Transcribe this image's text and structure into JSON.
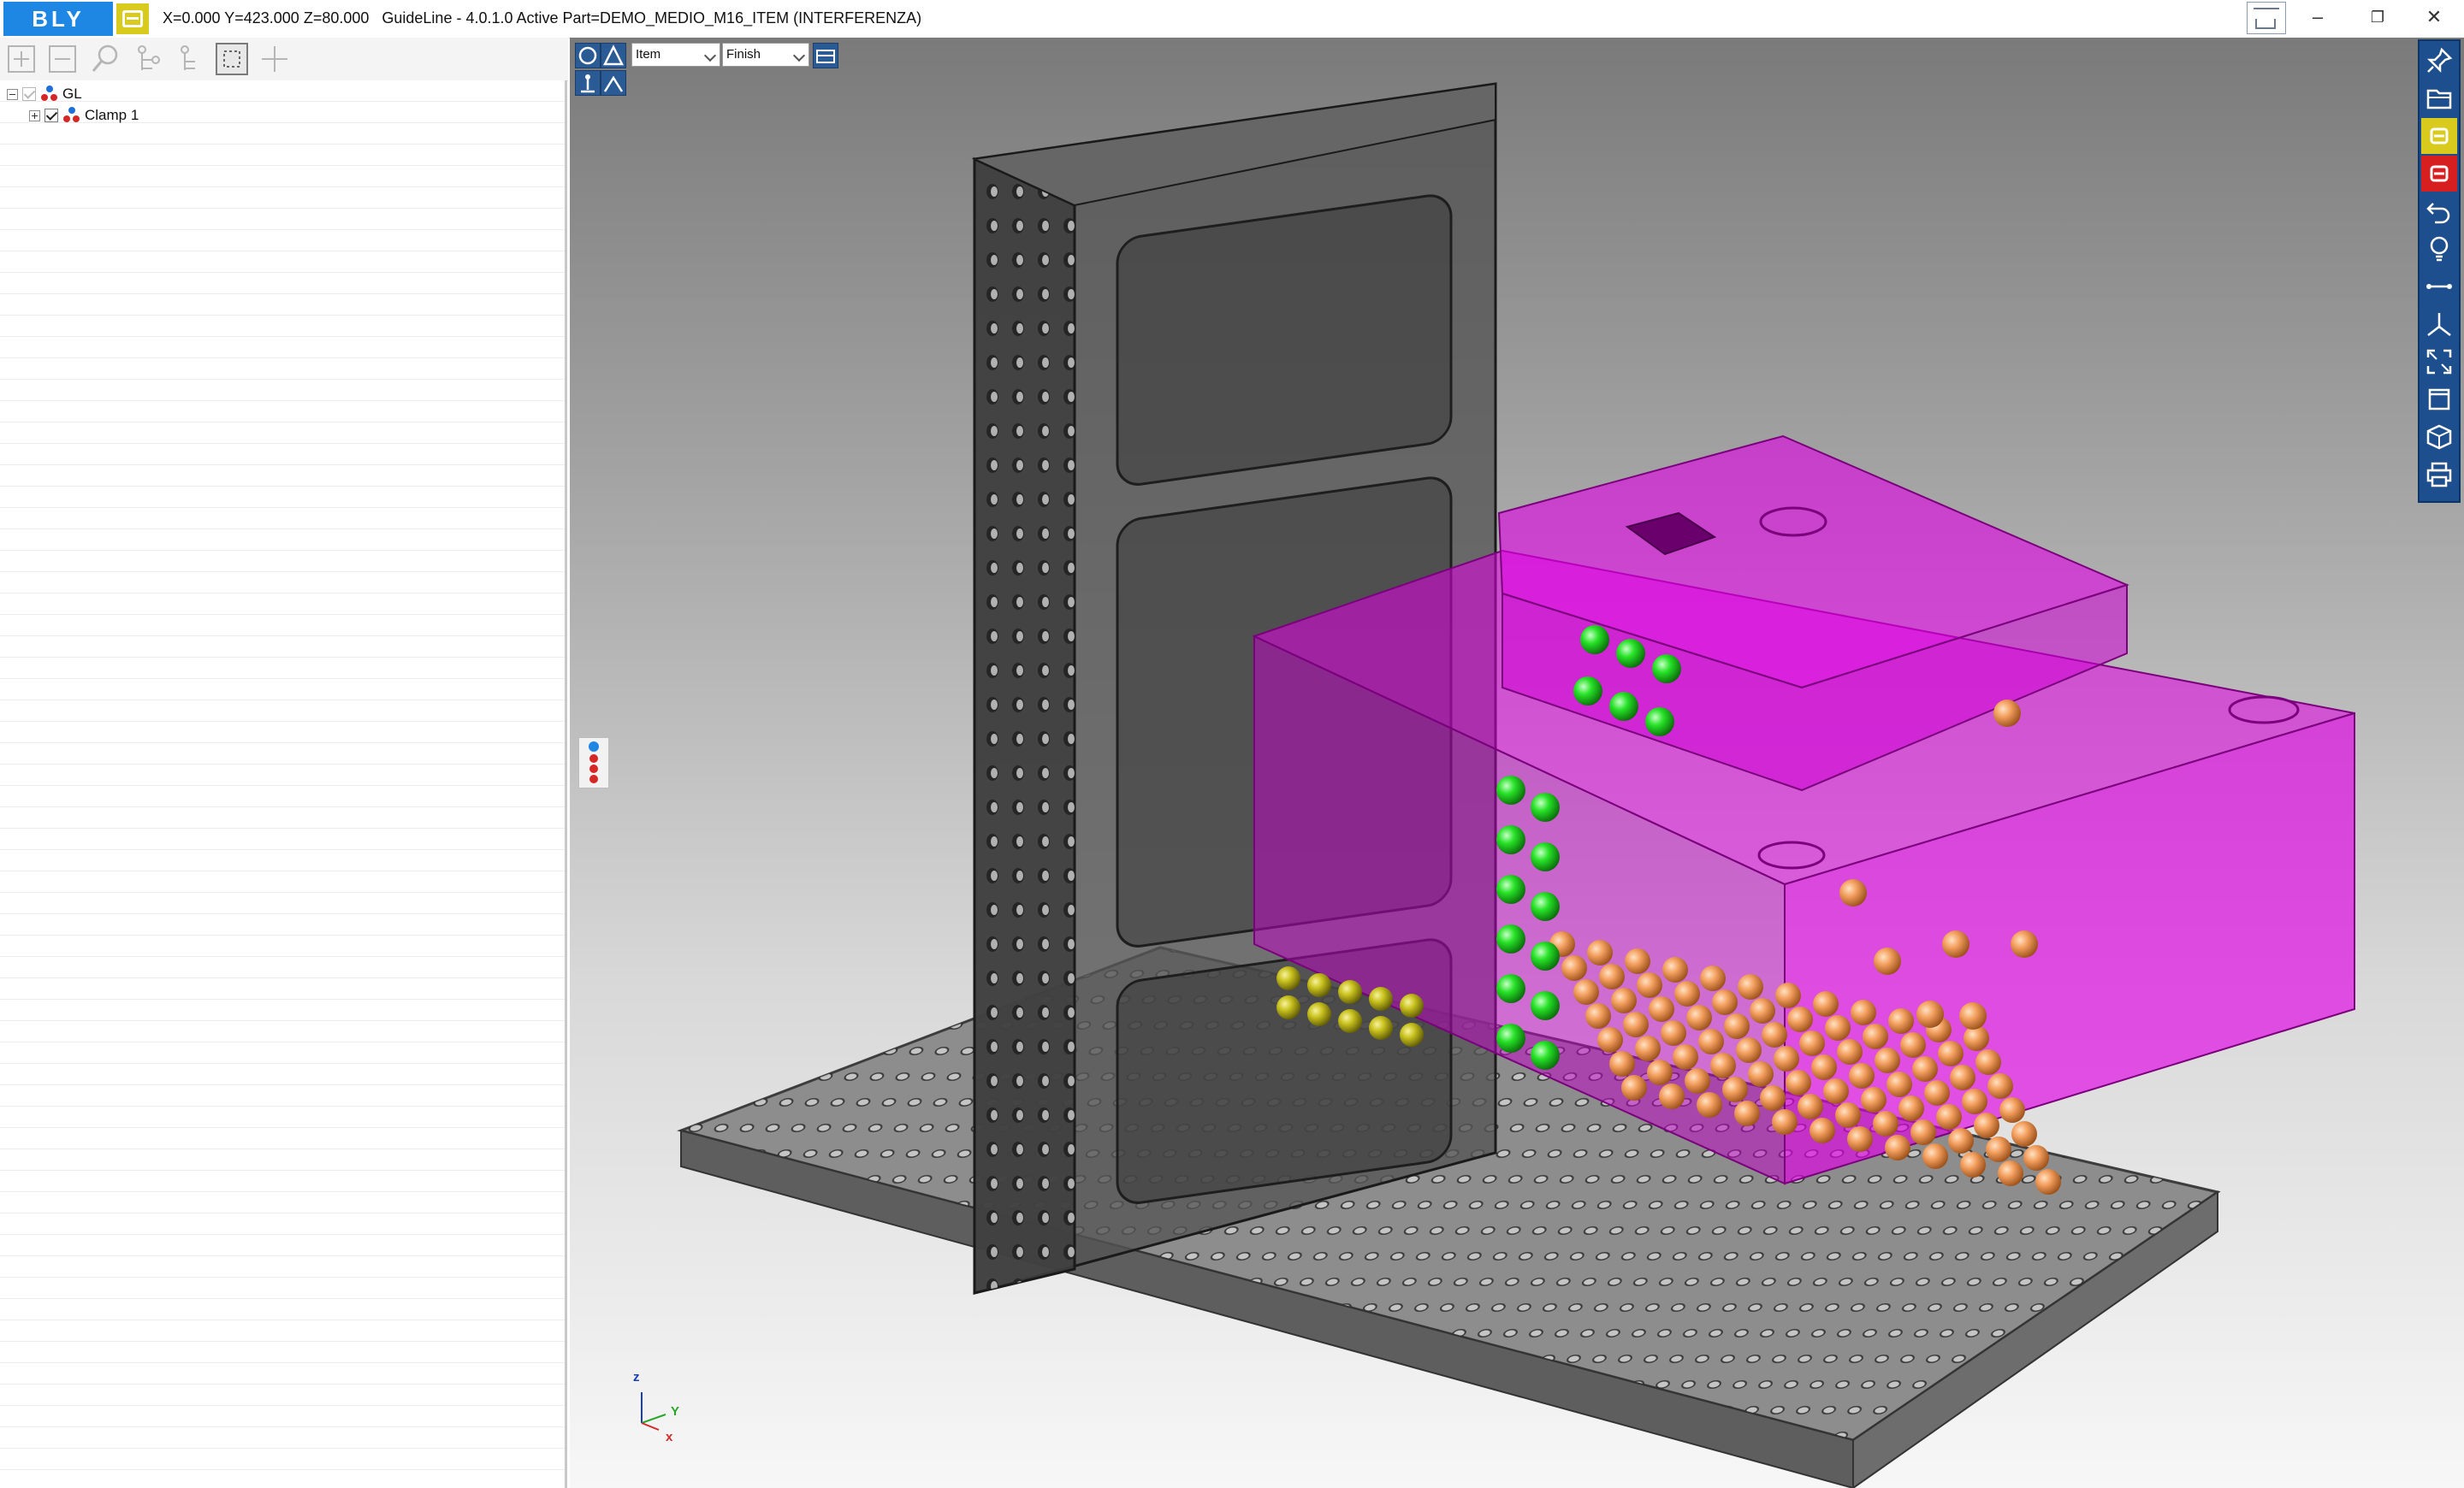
{
  "titlebar": {
    "logo": "BLY",
    "title": "X=0.000 Y=423.000 Z=80.000   GuideLine - 4.0.1.0 Active Part=DEMO_MEDIO_M16_ITEM (INTERFERENZA)",
    "minimize_glyph": "–",
    "restore_glyph": "❐",
    "close_glyph": "✕"
  },
  "left_toolbar": {
    "icons": [
      "expand-all-icon",
      "collapse-all-icon",
      "search-icon",
      "tree-add-icon",
      "tree-remove-icon",
      "select-frame-icon",
      "crosshair-add-icon"
    ]
  },
  "tree": {
    "items": [
      {
        "label": "GL",
        "expanded": true,
        "checked": true,
        "level": 0
      },
      {
        "label": "Clamp 1",
        "expanded": false,
        "checked": true,
        "level": 1
      }
    ]
  },
  "viewport": {
    "mode_select": {
      "value": "Item"
    },
    "finish_select": {
      "value": "Finish"
    },
    "axis": {
      "z": "z",
      "y": "Y",
      "x": "x"
    },
    "colors": {
      "background_top": "#7a7a7a",
      "background_bottom": "#f7f7f7",
      "part": "#e100e6",
      "fixture": "#4d4d4d",
      "contact_green": "#27e227",
      "contact_orange": "#f4a060",
      "contact_yellow": "#c9c21e"
    }
  },
  "right_toolbar": {
    "icons": [
      "pin-icon",
      "folder-open-icon",
      "bly-yellow-icon",
      "bly-red-icon",
      "undo-icon",
      "lightbulb-icon",
      "measure-line-icon",
      "axis-icon",
      "fit-view-icon",
      "window-icon",
      "cube-view-icon",
      "print-icon"
    ]
  }
}
